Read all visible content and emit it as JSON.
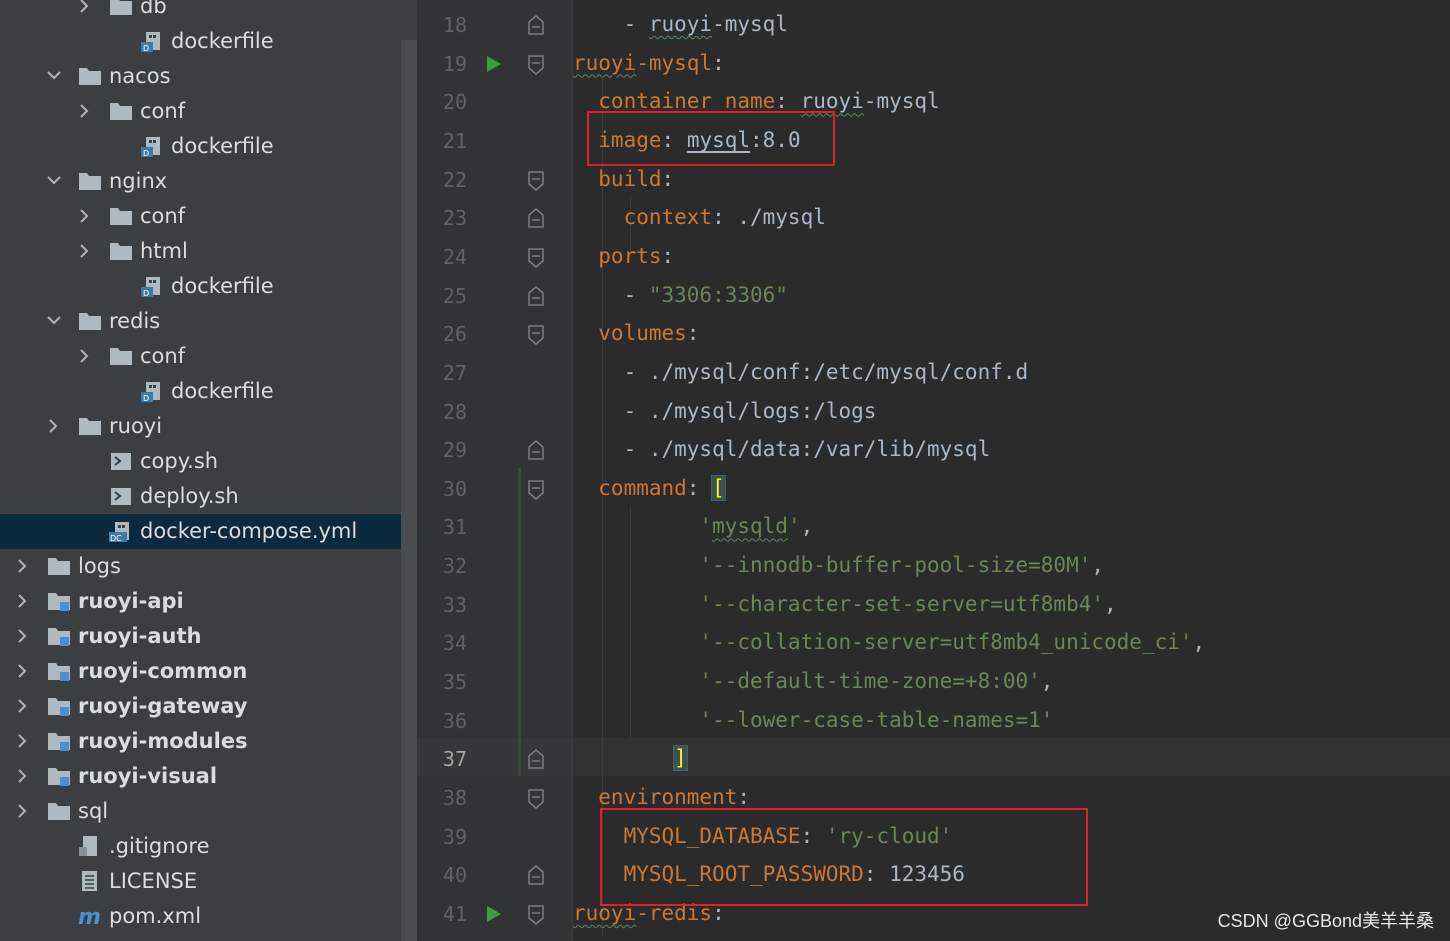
{
  "tree": {
    "items": [
      {
        "label": "db",
        "depth": 2,
        "kind": "folder",
        "expand": "collapsed"
      },
      {
        "label": "dockerfile",
        "depth": 3,
        "kind": "docker",
        "expand": "none"
      },
      {
        "label": "nacos",
        "depth": 1,
        "kind": "folder",
        "expand": "expanded"
      },
      {
        "label": "conf",
        "depth": 2,
        "kind": "folder",
        "expand": "collapsed"
      },
      {
        "label": "dockerfile",
        "depth": 3,
        "kind": "docker",
        "expand": "none"
      },
      {
        "label": "nginx",
        "depth": 1,
        "kind": "folder",
        "expand": "expanded"
      },
      {
        "label": "conf",
        "depth": 2,
        "kind": "folder",
        "expand": "collapsed"
      },
      {
        "label": "html",
        "depth": 2,
        "kind": "folder",
        "expand": "collapsed"
      },
      {
        "label": "dockerfile",
        "depth": 3,
        "kind": "docker",
        "expand": "none"
      },
      {
        "label": "redis",
        "depth": 1,
        "kind": "folder",
        "expand": "expanded"
      },
      {
        "label": "conf",
        "depth": 2,
        "kind": "folder",
        "expand": "collapsed"
      },
      {
        "label": "dockerfile",
        "depth": 3,
        "kind": "docker",
        "expand": "none"
      },
      {
        "label": "ruoyi",
        "depth": 1,
        "kind": "folder",
        "expand": "collapsed"
      },
      {
        "label": "copy.sh",
        "depth": 2,
        "kind": "shell",
        "expand": "none"
      },
      {
        "label": "deploy.sh",
        "depth": 2,
        "kind": "shell",
        "expand": "none"
      },
      {
        "label": "docker-compose.yml",
        "depth": 2,
        "kind": "compose",
        "expand": "none",
        "selected": true
      },
      {
        "label": "logs",
        "depth": 0,
        "kind": "folder",
        "expand": "collapsed"
      },
      {
        "label": "ruoyi-api",
        "depth": 0,
        "kind": "module",
        "expand": "collapsed"
      },
      {
        "label": "ruoyi-auth",
        "depth": 0,
        "kind": "module",
        "expand": "collapsed"
      },
      {
        "label": "ruoyi-common",
        "depth": 0,
        "kind": "module",
        "expand": "collapsed"
      },
      {
        "label": "ruoyi-gateway",
        "depth": 0,
        "kind": "module",
        "expand": "collapsed"
      },
      {
        "label": "ruoyi-modules",
        "depth": 0,
        "kind": "module",
        "expand": "collapsed"
      },
      {
        "label": "ruoyi-visual",
        "depth": 0,
        "kind": "module",
        "expand": "collapsed"
      },
      {
        "label": "sql",
        "depth": 0,
        "kind": "folder",
        "expand": "collapsed"
      },
      {
        "label": ".gitignore",
        "depth": 1,
        "kind": "gitignore",
        "expand": "none"
      },
      {
        "label": "LICENSE",
        "depth": 1,
        "kind": "text",
        "expand": "none"
      },
      {
        "label": "pom.xml",
        "depth": 1,
        "kind": "maven",
        "expand": "none"
      }
    ]
  },
  "editor": {
    "current_line": 37,
    "lines": [
      {
        "n": 18,
        "fold": "mid",
        "tokens": [
          [
            "p",
            "    - "
          ],
          [
            "p~",
            "ruoyi"
          ],
          [
            "p",
            "-mysql"
          ]
        ]
      },
      {
        "n": 19,
        "fold": "open",
        "run": true,
        "tokens": [
          [
            "k~",
            "ruoyi"
          ],
          [
            "k",
            "-mysql"
          ],
          [
            "p",
            ":"
          ]
        ]
      },
      {
        "n": 20,
        "fold": "none",
        "tokens": [
          [
            "k",
            "  container_name"
          ],
          [
            "p",
            ": "
          ],
          [
            "p~",
            "ruoyi"
          ],
          [
            "p",
            "-mysql"
          ]
        ]
      },
      {
        "n": 21,
        "fold": "none",
        "tokens": [
          [
            "k",
            "  image"
          ],
          [
            "p",
            ": "
          ],
          [
            "pu",
            "mysql"
          ],
          [
            "p",
            ":8.0"
          ]
        ]
      },
      {
        "n": 22,
        "fold": "open",
        "tokens": [
          [
            "k",
            "  build"
          ],
          [
            "p",
            ":"
          ]
        ]
      },
      {
        "n": 23,
        "fold": "end",
        "tokens": [
          [
            "k",
            "    context"
          ],
          [
            "p",
            ": ./mysql"
          ]
        ]
      },
      {
        "n": 24,
        "fold": "open",
        "tokens": [
          [
            "k",
            "  ports"
          ],
          [
            "p",
            ":"
          ]
        ]
      },
      {
        "n": 25,
        "fold": "end",
        "tokens": [
          [
            "p",
            "    - "
          ],
          [
            "s",
            "\"3306:3306\""
          ]
        ]
      },
      {
        "n": 26,
        "fold": "open",
        "tokens": [
          [
            "k",
            "  volumes"
          ],
          [
            "p",
            ":"
          ]
        ]
      },
      {
        "n": 27,
        "fold": "none",
        "tokens": [
          [
            "p",
            "    - ./mysql/conf:/etc/mysql/conf.d"
          ]
        ]
      },
      {
        "n": 28,
        "fold": "none",
        "tokens": [
          [
            "p",
            "    - ./mysql/logs:/logs"
          ]
        ]
      },
      {
        "n": 29,
        "fold": "end",
        "tokens": [
          [
            "p",
            "    - ./mysql/data:/var/lib/mysql"
          ]
        ]
      },
      {
        "n": 30,
        "fold": "open",
        "tokens": [
          [
            "k",
            "  command"
          ],
          [
            "p",
            ": "
          ],
          [
            "b",
            "["
          ]
        ]
      },
      {
        "n": 31,
        "fold": "none",
        "tokens": [
          [
            "s",
            "          '"
          ],
          [
            "s~",
            "mysqld"
          ],
          [
            "s",
            "'"
          ],
          [
            "p",
            ","
          ]
        ]
      },
      {
        "n": 32,
        "fold": "none",
        "tokens": [
          [
            "s",
            "          '--innodb-buffer-pool-size=80M'"
          ],
          [
            "p",
            ","
          ]
        ]
      },
      {
        "n": 33,
        "fold": "none",
        "tokens": [
          [
            "s",
            "          '--character-set-server=utf8mb4'"
          ],
          [
            "p",
            ","
          ]
        ]
      },
      {
        "n": 34,
        "fold": "none",
        "tokens": [
          [
            "s",
            "          '--collation-server=utf8mb4_unicode_ci'"
          ],
          [
            "p",
            ","
          ]
        ]
      },
      {
        "n": 35,
        "fold": "none",
        "tokens": [
          [
            "s",
            "          '--default-time-zone=+8:00'"
          ],
          [
            "p",
            ","
          ]
        ]
      },
      {
        "n": 36,
        "fold": "none",
        "tokens": [
          [
            "s",
            "          '--lower-case-table-names=1'"
          ]
        ]
      },
      {
        "n": 37,
        "fold": "end",
        "tokens": [
          [
            "p",
            "        "
          ],
          [
            "b",
            "]"
          ]
        ]
      },
      {
        "n": 38,
        "fold": "open",
        "tokens": [
          [
            "k",
            "  environment"
          ],
          [
            "p",
            ":"
          ]
        ]
      },
      {
        "n": 39,
        "fold": "none",
        "tokens": [
          [
            "k",
            "    MYSQL_DATABASE"
          ],
          [
            "p",
            ": "
          ],
          [
            "s",
            "'ry-cloud'"
          ]
        ]
      },
      {
        "n": 40,
        "fold": "end",
        "tokens": [
          [
            "k",
            "    MYSQL_ROOT_PASSWORD"
          ],
          [
            "p",
            ": 123456"
          ]
        ]
      },
      {
        "n": 41,
        "fold": "open",
        "run": true,
        "tokens": [
          [
            "k~",
            "ruoyi"
          ],
          [
            "k",
            "-redis"
          ],
          [
            "p",
            ":"
          ]
        ]
      }
    ]
  },
  "colors": {
    "accent_highlight": "#e0202a",
    "keyword": "#cc7832",
    "string": "#6a8759",
    "plain": "#a9b7c6",
    "selection": "#0d293e",
    "run_icon": "#3d9e3d"
  },
  "watermark": "CSDN @GGBond美羊羊桑"
}
